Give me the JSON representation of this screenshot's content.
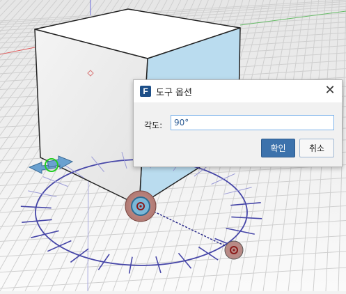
{
  "dialog": {
    "app_icon_letter": "F",
    "title": "도구 옵션",
    "close_symbol": "✕",
    "angle_label": "각도:",
    "angle_value": "90°",
    "ok_label": "확인",
    "cancel_label": "취소"
  },
  "viewport": {
    "tool": "rotate-handle",
    "icons": [
      "rotate-arrow-icon",
      "move-handle-icon"
    ]
  },
  "colors": {
    "accent": "#3c72ac",
    "input_border": "#7eb4ea",
    "protractor": "#4545a8",
    "cube_face_right": "#b9daee",
    "axis_red": "#e05050",
    "axis_green": "#55bb55",
    "axis_blue": "#5555dd"
  }
}
